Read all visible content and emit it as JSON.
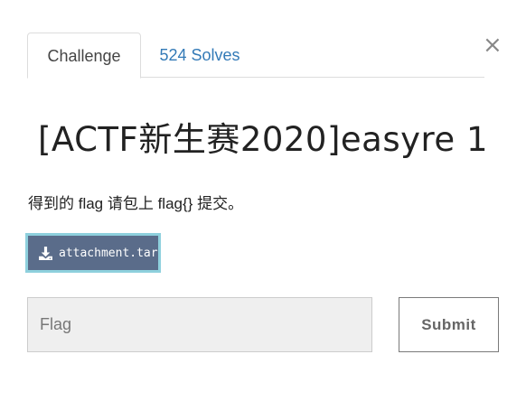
{
  "close": {
    "symbol": "×"
  },
  "tabs": [
    {
      "label": "Challenge",
      "active": true
    },
    {
      "label": "524 Solves",
      "active": false
    }
  ],
  "challenge": {
    "title": "[ACTF新生赛2020]easyre 1",
    "description": "得到的 flag 请包上 flag{} 提交。"
  },
  "attachment": {
    "label": "attachment.tar",
    "icon": "download-icon"
  },
  "flag_form": {
    "placeholder": "Flag",
    "value": "",
    "submit_label": "Submit"
  },
  "colors": {
    "link": "#337ab7",
    "attachment_bg": "#5a6c8a",
    "attachment_border": "#8ed0dd",
    "input_bg": "#efefef"
  }
}
